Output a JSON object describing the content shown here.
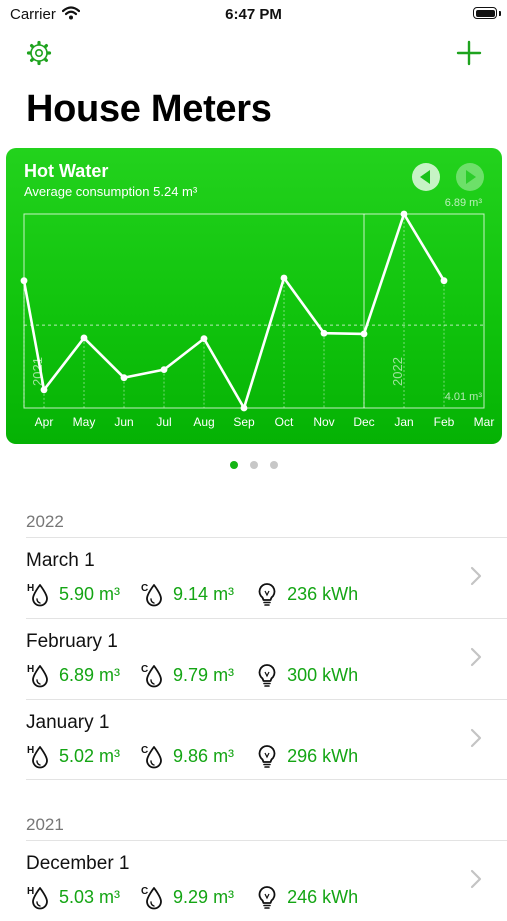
{
  "status_bar": {
    "carrier": "Carrier",
    "time": "6:47 PM"
  },
  "nav": {
    "settings_icon": "gear-icon",
    "add_icon": "plus-icon"
  },
  "title": "House Meters",
  "card": {
    "title": "Hot Water",
    "subtitle": "Average consumption 5.24 m³",
    "prev_icon": "arrow-left-circle-icon",
    "next_icon": "arrow-right-circle-icon",
    "colors": {
      "gradient_top": "#23d21d",
      "gradient_bottom": "#05b204",
      "line": "#ffffff"
    }
  },
  "chart_data": {
    "type": "line",
    "title": "Hot Water",
    "subtitle": "Average consumption 5.24 m³",
    "categories": [
      "Apr",
      "May",
      "Jun",
      "Jul",
      "Aug",
      "Sep",
      "Oct",
      "Nov",
      "Dec",
      "Jan",
      "Feb",
      "Mar"
    ],
    "point_labels": [
      "",
      "",
      "",
      "",
      "",
      "",
      "",
      "",
      "",
      "",
      "",
      "",
      "",
      "",
      "",
      "",
      ""
    ],
    "series": [
      {
        "x": [
          0,
          0.5,
          1.5,
          2.5,
          3.5,
          4.5,
          5.5,
          6.5,
          7.5,
          8.5,
          9.5,
          10.5
        ],
        "values": [
          5.9,
          4.28,
          5.05,
          4.46,
          4.58,
          5.04,
          4.01,
          5.94,
          5.12,
          5.11,
          6.89,
          5.9
        ]
      }
    ],
    "average": 5.24,
    "max_label": "6.89 m³",
    "min_label": "4.01 m³",
    "year_labels": [
      {
        "text": "2021",
        "at": 0
      },
      {
        "text": "2022",
        "at": 9
      }
    ],
    "ylim": [
      4.01,
      6.89
    ],
    "grid": "vertical",
    "legend": "none"
  },
  "page_dots": {
    "count": 3,
    "active": 0
  },
  "sections": [
    {
      "year": "2022",
      "rows": [
        {
          "date": "March 1",
          "hot": "5.90 m³",
          "cold": "9.14 m³",
          "power": "236 kWh"
        },
        {
          "date": "February 1",
          "hot": "6.89 m³",
          "cold": "9.79 m³",
          "power": "300 kWh"
        },
        {
          "date": "January 1",
          "hot": "5.02 m³",
          "cold": "9.86 m³",
          "power": "296 kWh"
        }
      ]
    },
    {
      "year": "2021",
      "rows": [
        {
          "date": "December 1",
          "hot": "5.03 m³",
          "cold": "9.29 m³",
          "power": "246 kWh"
        }
      ]
    }
  ],
  "row_icons": {
    "hot": "hot-water-drop-icon",
    "cold": "cold-water-drop-icon",
    "power": "lightbulb-icon",
    "chevron": "chevron-right-icon"
  }
}
